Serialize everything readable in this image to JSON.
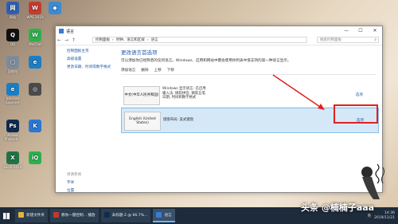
{
  "desktop": {
    "icons": [
      {
        "label": "网站",
        "color": "#2f5fb3",
        "glyph": "网"
      },
      {
        "label": "WPS 2019",
        "color": "#c53b31",
        "glyph": "W"
      },
      {
        "label": "",
        "color": "#3a8bd6",
        "glyph": "◆"
      },
      {
        "label": "QQ",
        "color": "#111",
        "glyph": "Q"
      },
      {
        "label": "WeChat",
        "color": "#2bb24c",
        "glyph": "W"
      },
      {
        "label": "回收站",
        "color": "#7c8c9a",
        "glyph": "▢"
      },
      {
        "label": "",
        "color": "#1b7ec4",
        "glyph": "e"
      },
      {
        "label": "Internet Explorer",
        "color": "#1b7ec4",
        "glyph": "e"
      },
      {
        "label": "",
        "color": "#4b4b4b",
        "glyph": "◎"
      },
      {
        "label": "Adobe Photosh...",
        "color": "#0f2c4f",
        "glyph": "Ps"
      },
      {
        "label": "",
        "color": "#2a77d4",
        "glyph": "K"
      },
      {
        "label": "Excel 2019",
        "color": "#217346",
        "glyph": "X"
      },
      {
        "label": "",
        "color": "#2bb24c",
        "glyph": "iQ"
      }
    ]
  },
  "window": {
    "title": "语言",
    "min": "—",
    "max": "☐",
    "close": "✕",
    "breadcrumb": [
      "控制面板",
      "›",
      "时钟、语言和区域",
      "›",
      "语言"
    ],
    "search_placeholder": "搜索控制面板"
  },
  "left_nav": {
    "items": [
      "控制面板主页",
      "高级设置",
      "更改日期、时间或数字格式"
    ],
    "see_also_header": "另请参阅",
    "see_also": [
      "字体",
      "位置"
    ]
  },
  "main": {
    "heading": "更改语言首选项",
    "description": "可以添加你已经熟悉的任何语言。Windows、应用和网站中都会使用你列表中受支持的第一种语言显示。",
    "toolbar": [
      "添加语言",
      "删除",
      "上移",
      "下移"
    ],
    "languages": [
      {
        "name": "中文(中华人民共和国)",
        "details": [
          "Windows 显示语言: 已启用",
          "输入法: 微软拼音, 微软五笔",
          "日期, 时间和数字格式"
        ],
        "options": "选项"
      },
      {
        "name": "English (United States)",
        "details": [
          "键盘布局: 美式键盘"
        ],
        "options": "选项"
      }
    ]
  },
  "taskbar": {
    "tasks": [
      {
        "label": "新建文件夹",
        "color": "#e4b33a",
        "active": false
      },
      {
        "label": "教你一键控制... 播放",
        "color": "#c0392b",
        "active": false
      },
      {
        "label": "未标题-2 @ 66.7%...",
        "color": "#0f2c4f",
        "active": false
      },
      {
        "label": "语言",
        "color": "#3a7bd5",
        "active": true
      }
    ],
    "tray_text": "英",
    "time": "14:36",
    "date": "2019/11/21"
  },
  "watermark": "头条 @楠楠子aaa",
  "colors": {
    "accent": "#1e5aa8",
    "highlight": "#d5e8f8",
    "annotation": "#e02020"
  }
}
